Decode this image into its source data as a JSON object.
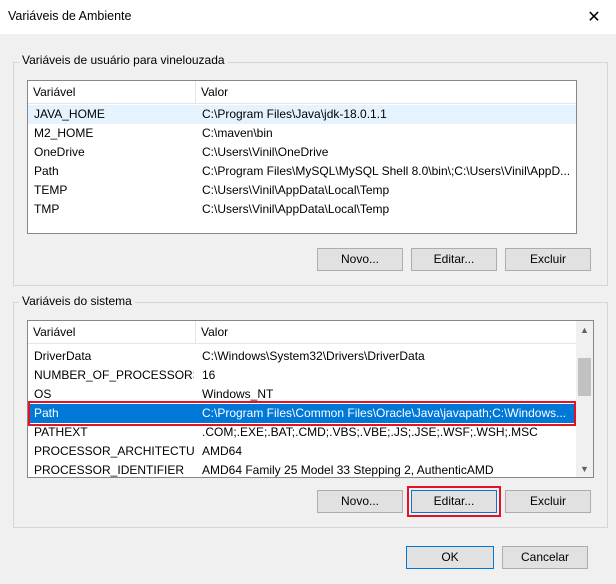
{
  "window": {
    "title": "Variáveis de Ambiente",
    "close_glyph": "✕"
  },
  "user_vars": {
    "group_label": "Variáveis de usuário para vinelouzada",
    "headers": [
      "Variável",
      "Valor"
    ],
    "rows": [
      [
        "JAVA_HOME",
        "C:\\Program Files\\Java\\jdk-18.0.1.1"
      ],
      [
        "M2_HOME",
        "C:\\maven\\bin"
      ],
      [
        "OneDrive",
        "C:\\Users\\Vinil\\OneDrive"
      ],
      [
        "Path",
        "C:\\Program Files\\MySQL\\MySQL Shell 8.0\\bin\\;C:\\Users\\Vinil\\AppD..."
      ],
      [
        "TEMP",
        "C:\\Users\\Vinil\\AppData\\Local\\Temp"
      ],
      [
        "TMP",
        "C:\\Users\\Vinil\\AppData\\Local\\Temp"
      ]
    ],
    "buttons": {
      "new": "Novo...",
      "edit": "Editar...",
      "delete": "Excluir"
    }
  },
  "system_vars": {
    "group_label": "Variáveis do sistema",
    "headers": [
      "Variável",
      "Valor"
    ],
    "rows": [
      [
        "DriverData",
        "C:\\Windows\\System32\\Drivers\\DriverData"
      ],
      [
        "NUMBER_OF_PROCESSORS",
        "16"
      ],
      [
        "OS",
        "Windows_NT"
      ],
      [
        "Path",
        "C:\\Program Files\\Common Files\\Oracle\\Java\\javapath;C:\\Windows..."
      ],
      [
        "PATHEXT",
        ".COM;.EXE;.BAT;.CMD;.VBS;.VBE;.JS;.JSE;.WSF;.WSH;.MSC"
      ],
      [
        "PROCESSOR_ARCHITECTURE",
        "AMD64"
      ],
      [
        "PROCESSOR_IDENTIFIER",
        "AMD64 Family 25 Model 33 Stepping 2, AuthenticAMD"
      ]
    ],
    "selected_row": "Path",
    "buttons": {
      "new": "Novo...",
      "edit": "Editar...",
      "delete": "Excluir"
    }
  },
  "footer": {
    "ok": "OK",
    "cancel": "Cancelar"
  },
  "colors": {
    "selection": "#0078d7",
    "highlight_box": "#e81123"
  }
}
